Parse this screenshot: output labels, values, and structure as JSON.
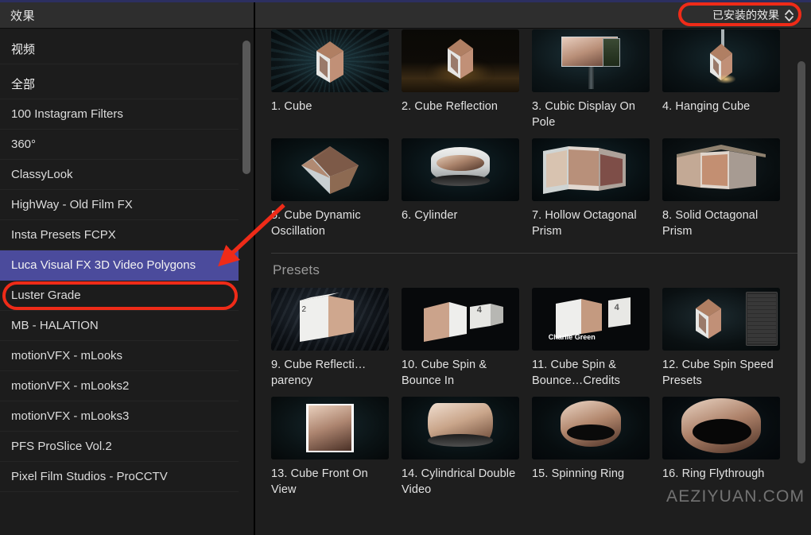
{
  "window": {
    "accent_top_color": "#2c2f60",
    "background": "#1b1b1b"
  },
  "left_panel": {
    "title": "效果",
    "items": [
      {
        "label": "视频",
        "type": "group",
        "selected": false
      },
      {
        "label": "全部",
        "type": "group",
        "selected": false
      },
      {
        "label": "100 Instagram Filters",
        "type": "item",
        "selected": false
      },
      {
        "label": "360°",
        "type": "item",
        "selected": false
      },
      {
        "label": "ClassyLook",
        "type": "item",
        "selected": false
      },
      {
        "label": "HighWay - Old Film FX",
        "type": "item",
        "selected": false
      },
      {
        "label": "Insta Presets FCPX",
        "type": "item",
        "selected": false
      },
      {
        "label": "Luca Visual FX 3D Video Polygons",
        "type": "item",
        "selected": true
      },
      {
        "label": "Luster Grade",
        "type": "item",
        "selected": false
      },
      {
        "label": "MB - HALATION",
        "type": "item",
        "selected": false
      },
      {
        "label": "motionVFX - mLooks",
        "type": "item",
        "selected": false
      },
      {
        "label": "motionVFX - mLooks2",
        "type": "item",
        "selected": false
      },
      {
        "label": "motionVFX - mLooks3",
        "type": "item",
        "selected": false
      },
      {
        "label": "PFS ProSlice Vol.2",
        "type": "item",
        "selected": false
      },
      {
        "label": "Pixel Film Studios - ProCCTV",
        "type": "item",
        "selected": false
      }
    ]
  },
  "right_panel": {
    "filter_dropdown": {
      "label": "已安装的效果",
      "icon": "chevron-up-down-icon"
    },
    "sections": [
      {
        "title": "",
        "show_title": false,
        "effects": [
          {
            "name": "1. Cube",
            "thumb": "cube-on-teal-rays"
          },
          {
            "name": "2. Cube Reflection",
            "thumb": "cube-reflection-warm-floor"
          },
          {
            "name": "3. Cubic Display On Pole",
            "thumb": "cubic-display-pole"
          },
          {
            "name": "4. Hanging Cube",
            "thumb": "hanging-cube-from-rod"
          },
          {
            "name": "5. Cube Dynamic Oscillation",
            "thumb": "cube-dynamic-oscillation"
          },
          {
            "name": "6. Cylinder",
            "thumb": "cylinder-white-ring"
          },
          {
            "name": "7. Hollow Octagonal Prism",
            "thumb": "hollow-octagonal-prism"
          },
          {
            "name": "8. Solid Octagonal Prism",
            "thumb": "solid-octagonal-prism"
          }
        ]
      },
      {
        "title": "Presets",
        "show_title": true,
        "effects": [
          {
            "name": "9. Cube Reflecti…parency",
            "thumb": "cube-reflection-transparency"
          },
          {
            "name": "10. Cube Spin & Bounce In",
            "thumb": "cube-spin-bounce-in"
          },
          {
            "name": "11. Cube Spin & Bounce…Credits",
            "thumb": "cube-spin-bounce-credits"
          },
          {
            "name": "12. Cube Spin Speed Presets",
            "thumb": "cube-spin-speed-presets"
          },
          {
            "name": "13. Cube Front On View",
            "thumb": "cube-front-on-view"
          },
          {
            "name": "14. Cylindrical Double Video",
            "thumb": "cylindrical-double-video"
          },
          {
            "name": "15. Spinning Ring",
            "thumb": "spinning-ring"
          },
          {
            "name": "16. Ring Flythrough",
            "thumb": "ring-flythrough"
          }
        ]
      }
    ]
  },
  "annotations": {
    "highlight_color": "#ef2b18",
    "dropdown_ellipse": true,
    "sidebar_ellipse": true,
    "arrow_to_selected_item": true
  },
  "watermark": {
    "text": "AEZIYUAN.COM"
  }
}
